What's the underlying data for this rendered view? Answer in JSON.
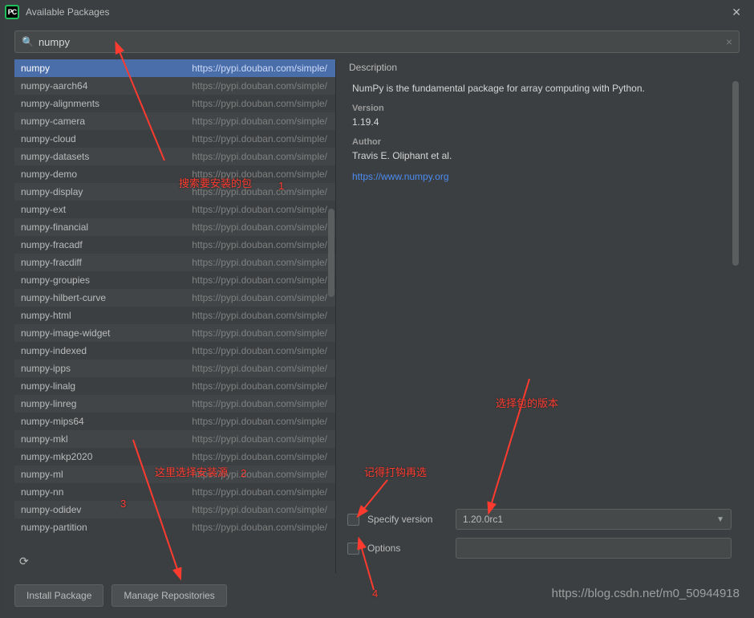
{
  "window": {
    "title": "Available Packages",
    "logo_text": "PC"
  },
  "search": {
    "value": "numpy",
    "placeholder": ""
  },
  "packages": {
    "selected_index": 0,
    "repo_url": "https://pypi.douban.com/simple/",
    "items": [
      {
        "name": "numpy"
      },
      {
        "name": "numpy-aarch64"
      },
      {
        "name": "numpy-alignments"
      },
      {
        "name": "numpy-camera"
      },
      {
        "name": "numpy-cloud"
      },
      {
        "name": "numpy-datasets"
      },
      {
        "name": "numpy-demo"
      },
      {
        "name": "numpy-display"
      },
      {
        "name": "numpy-ext"
      },
      {
        "name": "numpy-financial"
      },
      {
        "name": "numpy-fracadf"
      },
      {
        "name": "numpy-fracdiff"
      },
      {
        "name": "numpy-groupies"
      },
      {
        "name": "numpy-hilbert-curve"
      },
      {
        "name": "numpy-html"
      },
      {
        "name": "numpy-image-widget"
      },
      {
        "name": "numpy-indexed"
      },
      {
        "name": "numpy-ipps"
      },
      {
        "name": "numpy-linalg"
      },
      {
        "name": "numpy-linreg"
      },
      {
        "name": "numpy-mips64"
      },
      {
        "name": "numpy-mkl"
      },
      {
        "name": "numpy-mkp2020"
      },
      {
        "name": "numpy-ml"
      },
      {
        "name": "numpy-nn"
      },
      {
        "name": "numpy-odidev"
      },
      {
        "name": "numpy-partition"
      }
    ]
  },
  "description": {
    "heading": "Description",
    "text": "NumPy is the fundamental package for array computing with Python.",
    "version_label": "Version",
    "version_value": "1.19.4",
    "author_label": "Author",
    "author_value": "Travis E. Oliphant et al.",
    "homepage": "https://www.numpy.org"
  },
  "options": {
    "specify_version_label": "Specify version",
    "specify_version_value": "1.20.0rc1",
    "options_label": "Options",
    "options_value": ""
  },
  "buttons": {
    "install": "Install Package",
    "manage_repos": "Manage Repositories"
  },
  "annotations": {
    "a1": "搜索要安装的包",
    "a1_num": "1",
    "a2": "这里选择安装源",
    "a2_num": "2",
    "a3_num": "3",
    "a4": "选择包的版本",
    "a5": "记得打钩再选",
    "a5_num": "4"
  },
  "watermark": "https://blog.csdn.net/m0_50944918"
}
